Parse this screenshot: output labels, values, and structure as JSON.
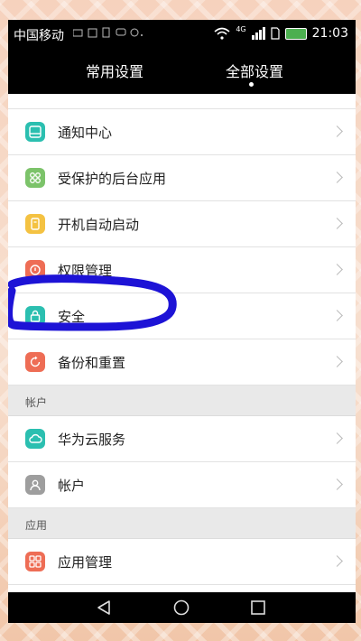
{
  "status_bar": {
    "carrier": "中国移动",
    "network": "4G",
    "time": "21:03"
  },
  "tabs": [
    {
      "label": "常用设置"
    },
    {
      "label": "全部设置"
    }
  ],
  "settings": {
    "items": [
      {
        "label": "通知中心",
        "icon": "notification-center-icon",
        "color": "#2bbfb0"
      },
      {
        "label": "受保护的后台应用",
        "icon": "protected-apps-icon",
        "color": "#7cc36a"
      },
      {
        "label": "开机自动启动",
        "icon": "startup-icon",
        "color": "#f4c242"
      },
      {
        "label": "权限管理",
        "icon": "permission-icon",
        "color": "#ee6d55"
      },
      {
        "label": "安全",
        "icon": "lock-icon",
        "color": "#2bbfb0"
      },
      {
        "label": "备份和重置",
        "icon": "backup-icon",
        "color": "#ee6d55"
      }
    ],
    "account_section": "帐户",
    "account_items": [
      {
        "label": "华为云服务",
        "icon": "cloud-icon",
        "color": "#2bbfb0"
      },
      {
        "label": "帐户",
        "icon": "user-icon",
        "color": "#9e9e9e"
      }
    ],
    "apps_section": "应用",
    "apps_items": [
      {
        "label": "应用管理",
        "icon": "apps-icon",
        "color": "#ee6d55"
      }
    ]
  },
  "colors": {
    "annotation": "#1d13d6"
  }
}
